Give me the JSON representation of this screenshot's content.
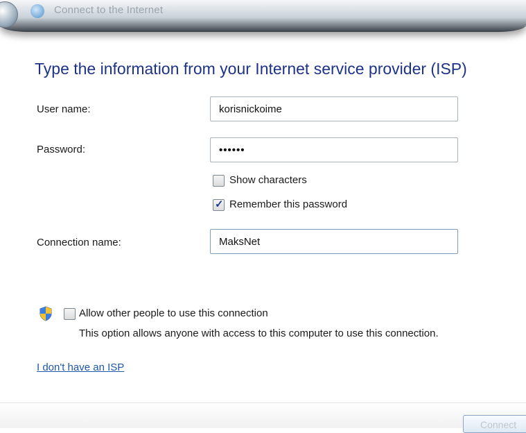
{
  "window": {
    "title": "Connect to the Internet"
  },
  "heading": "Type the information from your Internet service provider (ISP)",
  "form": {
    "username": {
      "label": "User name:",
      "value": "korisnickoime"
    },
    "password": {
      "label": "Password:",
      "value": "••••••"
    },
    "show_characters": {
      "label": "Show characters",
      "checked": false
    },
    "remember_password": {
      "label": "Remember this password",
      "checked": true
    },
    "connection_name": {
      "label": "Connection name:",
      "value": "MaksNet"
    }
  },
  "sharing": {
    "label": "Allow other people to use this connection",
    "checked": false,
    "description": "This option allows anyone with access to this computer to use this connection."
  },
  "links": {
    "no_isp": "I don't have an ISP"
  },
  "buttons": {
    "connect": "Connect"
  },
  "icons": {
    "back": "back-arrow-icon",
    "title": "network-globe-icon",
    "uac": "uac-shield-icon"
  },
  "colors": {
    "heading": "#1e3287",
    "link": "#1f57a8"
  }
}
